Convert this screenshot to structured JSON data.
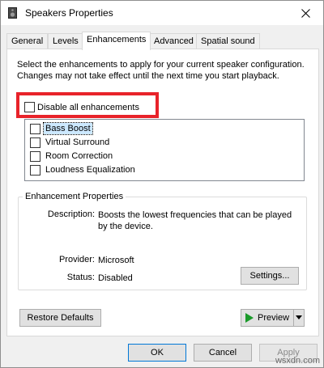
{
  "window": {
    "title": "Speakers Properties"
  },
  "tabs": [
    {
      "label": "General"
    },
    {
      "label": "Levels"
    },
    {
      "label": "Enhancements",
      "active": true
    },
    {
      "label": "Advanced"
    },
    {
      "label": "Spatial sound"
    }
  ],
  "enhancements": {
    "description": "Select the enhancements to apply for your current speaker configuration. Changes may not take effect until the next time you start playback.",
    "disable_all_label": "Disable all enhancements",
    "disable_all_checked": false,
    "items": [
      {
        "label": "Bass Boost",
        "checked": false,
        "selected": true
      },
      {
        "label": "Virtual Surround",
        "checked": false
      },
      {
        "label": "Room Correction",
        "checked": false
      },
      {
        "label": "Loudness Equalization",
        "checked": false
      }
    ]
  },
  "properties": {
    "group_title": "Enhancement Properties",
    "description_label": "Description:",
    "description_value": "Boosts the lowest frequencies that can be played by the device.",
    "provider_label": "Provider:",
    "provider_value": "Microsoft",
    "status_label": "Status:",
    "status_value": "Disabled",
    "settings_button": "Settings..."
  },
  "buttons": {
    "restore_defaults": "Restore Defaults",
    "preview": "Preview",
    "ok": "OK",
    "cancel": "Cancel",
    "apply": "Apply"
  },
  "watermark": "wsxdn.com",
  "colors": {
    "highlight_box": "#e8232a",
    "selection": "#cce8ff",
    "play_icon": "#1a9a2a",
    "primary_border": "#0078d7"
  }
}
